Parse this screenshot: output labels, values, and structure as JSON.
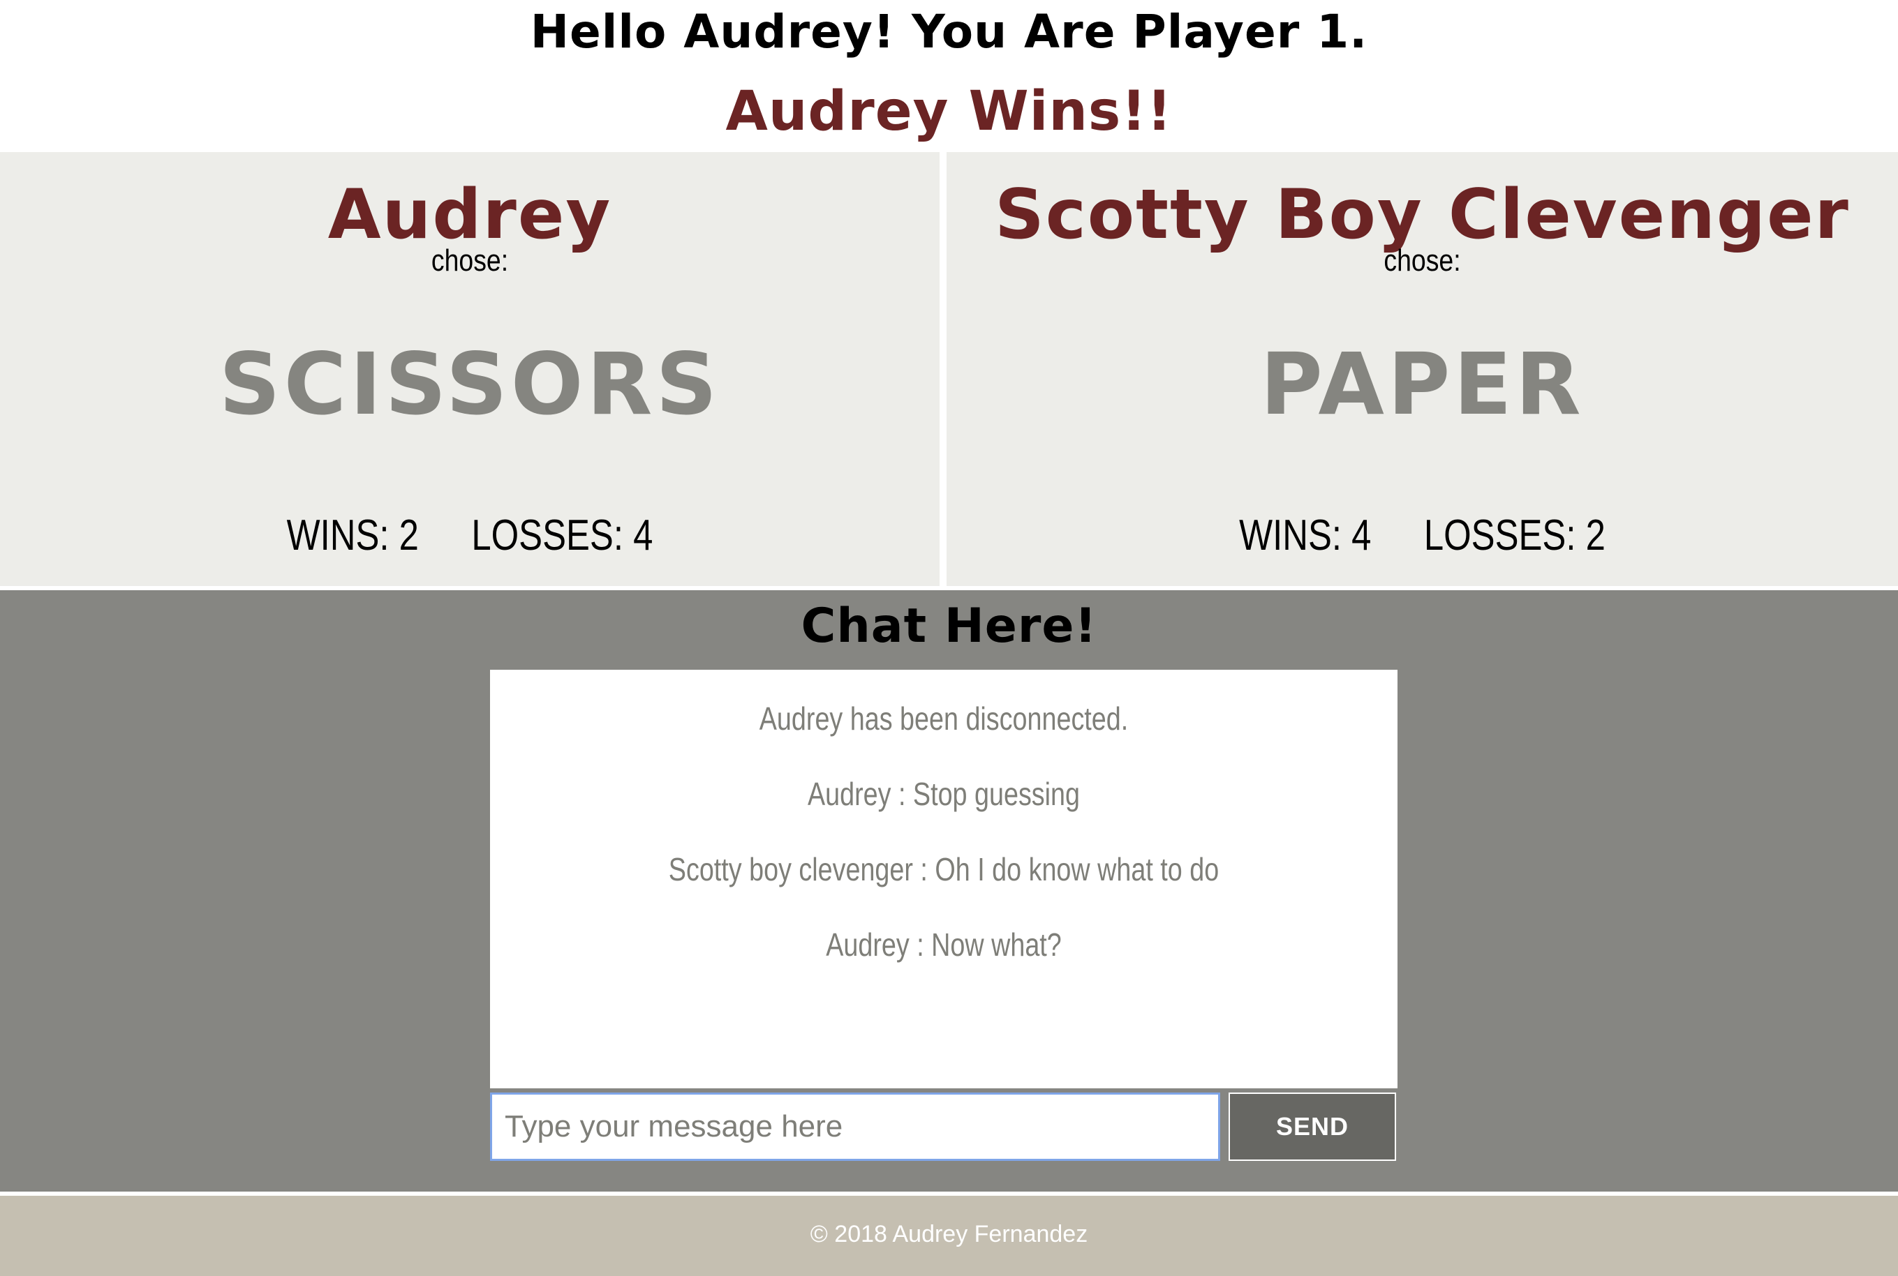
{
  "header": {
    "greeting": "Hello Audrey! You Are Player 1.",
    "result": "Audrey Wins!!"
  },
  "players": [
    {
      "name": "Audrey",
      "chose_label": "chose:",
      "choice": "SCISSORS",
      "wins": "WINS: 2",
      "losses": "LOSSES: 4"
    },
    {
      "name": "Scotty Boy Clevenger",
      "chose_label": "chose:",
      "choice": "PAPER",
      "wins": "WINS: 4",
      "losses": "LOSSES: 2"
    }
  ],
  "chat": {
    "title": "Chat Here!",
    "messages": [
      "Audrey has been disconnected.",
      "Audrey : Stop guessing",
      "Scotty boy clevenger : Oh I do know what to do",
      "Audrey : Now what?"
    ],
    "input": {
      "value": "",
      "placeholder": "Type your message here"
    },
    "send_label": "SEND"
  },
  "footer": {
    "copyright": "© 2018 Audrey Fernandez"
  },
  "colors": {
    "accent": "#6b2424",
    "panel_background": "#edede9",
    "chat_background": "#868682",
    "choice_text": "#858580",
    "send_button": "#676763",
    "footer_background": "#c5bfb1",
    "input_focus_border": "#7fa5e8"
  }
}
